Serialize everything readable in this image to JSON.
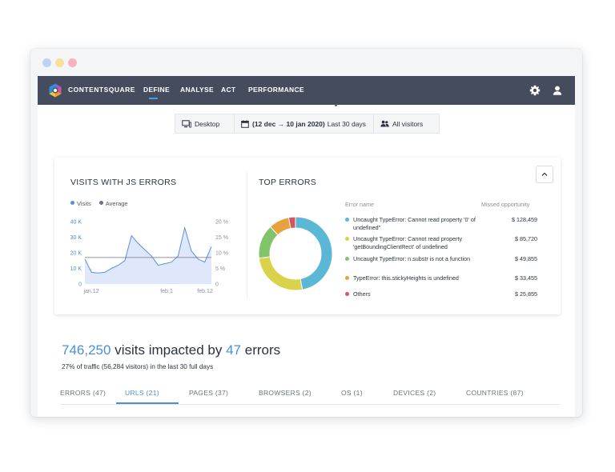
{
  "navbar": {
    "brand": "CONTENTSQUARE",
    "items": [
      {
        "label": "DEFINE",
        "active": true
      },
      {
        "label": "ANALYSE"
      },
      {
        "label": "ACT"
      },
      {
        "label": "PERFORMANCE"
      }
    ],
    "icons": [
      "gear-icon",
      "user-icon"
    ]
  },
  "filters": {
    "device": "Desktop",
    "date_range": "(12 dec → 10 jan 2020)",
    "date_label": "Last 30 days",
    "segment": "All visitors"
  },
  "visits_panel": {
    "title": "VISITS WITH JS ERRORS",
    "legend": [
      {
        "label": "Visits",
        "color": "#5b8fd9"
      },
      {
        "label": "Average",
        "color": "#6a7280"
      }
    ]
  },
  "chart_data": {
    "type": "area",
    "x": [
      "jan.12",
      "",
      "",
      "",
      "",
      "",
      "",
      "",
      "",
      "",
      "",
      "",
      "",
      "",
      "",
      "",
      "",
      "",
      "",
      ""
    ],
    "x_ticks": [
      "jan.12",
      "feb.1",
      "feb.12"
    ],
    "y_ticks_left": [
      "40 K",
      "30 K",
      "20 K",
      "10 K",
      "0"
    ],
    "y_ticks_right": [
      "20 %",
      "15 %",
      "10 %",
      "5 %",
      "0"
    ],
    "ylim": [
      0,
      40000
    ],
    "series": [
      {
        "name": "Visits",
        "color": "#5b8fd9",
        "values": [
          16000,
          7500,
          7000,
          7500,
          10000,
          12000,
          15000,
          31000,
          26000,
          22000,
          18000,
          12000,
          13000,
          14000,
          18000,
          36000,
          21000,
          16000,
          14000,
          24000
        ]
      },
      {
        "name": "Average",
        "color": "#6a7280",
        "values": [
          17000,
          17000,
          17000,
          17000,
          17000,
          17000,
          17000,
          17000,
          17000,
          17000,
          17000,
          17000,
          17000,
          17000,
          17000,
          17000,
          17000,
          17000,
          17000,
          17000
        ]
      }
    ]
  },
  "errors_panel": {
    "title": "TOP ERRORS",
    "col_name": "Error name",
    "col_value": "Missed opportunity",
    "rows": [
      {
        "name": "Uncaught TypeError: Cannot read property '0' of undefined\"",
        "value": "$ 128,459",
        "color": "#5ab7d6",
        "share": 0.47
      },
      {
        "name": "Uncaught TypeError: Cannot read property 'getBoundingClientRect' of undefined",
        "value": "$ 85,720",
        "color": "#d9d24a",
        "share": 0.26
      },
      {
        "name": "Uncaught TypeError: n.substr is not a function",
        "value": "$ 49,855",
        "color": "#82c46a",
        "share": 0.15
      },
      {
        "name": "TypeError: this.stickyHeights is undefined",
        "value": "$ 33,455",
        "color": "#e8a13f",
        "share": 0.09
      },
      {
        "name": "Others",
        "value": "$ 25,855",
        "color": "#d9535f",
        "share": 0.03
      }
    ]
  },
  "summary": {
    "visits": "746,250",
    "visits_text": "visits impacted by",
    "errors": "47",
    "errors_text": "errors",
    "subtitle": "27% of traffic (56,284 visitors) in the last 30 full days"
  },
  "tabs": [
    {
      "label": "ERRORS (47)"
    },
    {
      "label": "URLS (21)",
      "active": true
    },
    {
      "label": "PAGES (37)"
    },
    {
      "label": "BROWSERS (2)"
    },
    {
      "label": "OS (1)"
    },
    {
      "label": "DEVICES (2)"
    },
    {
      "label": "COUNTRIES (87)"
    }
  ]
}
